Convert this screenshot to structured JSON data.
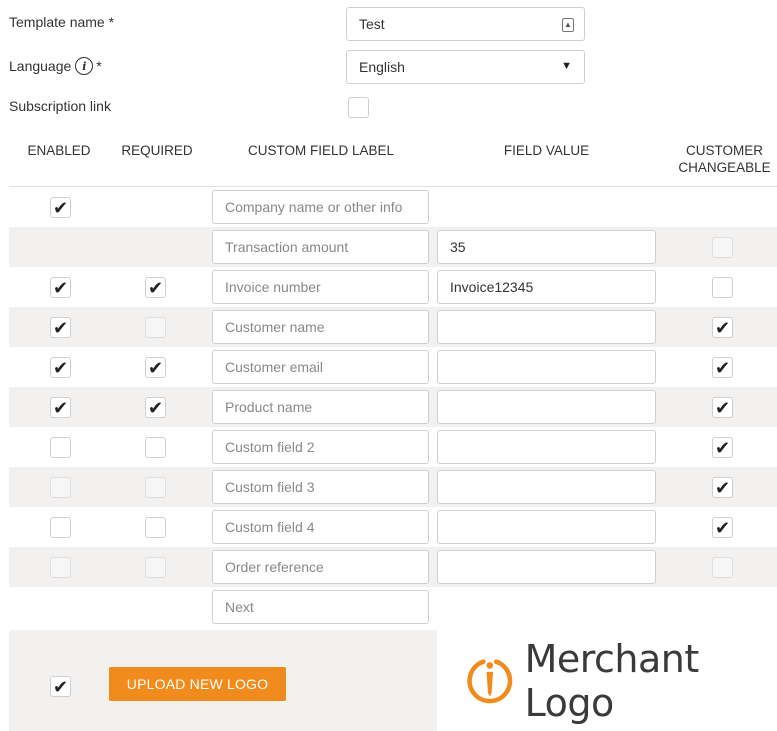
{
  "form": {
    "template_name_label": "Template name *",
    "template_name_value": "Test",
    "language_label": "Language",
    "language_required": "*",
    "language_value": "English",
    "subscription_label": "Subscription link",
    "subscription_checked": false
  },
  "table": {
    "headers": {
      "enabled": "ENABLED",
      "required": "REQUIRED",
      "label": "CUSTOM FIELD LABEL",
      "value": "FIELD VALUE",
      "changeable_1": "CUSTOMER",
      "changeable_2": "CHANGEABLE"
    },
    "rows": [
      {
        "label": "Company name or other info",
        "value": "",
        "enabled": true,
        "required": null,
        "changeable": null,
        "has_value": false
      },
      {
        "label": "Transaction amount",
        "value": "35",
        "enabled": null,
        "required": null,
        "changeable": "disabled",
        "has_value": true
      },
      {
        "label": "Invoice number",
        "value": "Invoice12345",
        "enabled": true,
        "required": true,
        "changeable": false,
        "has_value": true
      },
      {
        "label": "Customer name",
        "value": "",
        "enabled": true,
        "required": "disabled",
        "changeable": true,
        "has_value": true
      },
      {
        "label": "Customer email",
        "value": "",
        "enabled": true,
        "required": true,
        "changeable": true,
        "has_value": true
      },
      {
        "label": "Product name",
        "value": "",
        "enabled": true,
        "required": true,
        "changeable": true,
        "has_value": true
      },
      {
        "label": "Custom field 2",
        "value": "",
        "enabled": false,
        "required": false,
        "changeable": true,
        "has_value": true
      },
      {
        "label": "Custom field 3",
        "value": "",
        "enabled": "disabled",
        "required": "disabled",
        "changeable": true,
        "has_value": true
      },
      {
        "label": "Custom field 4",
        "value": "",
        "enabled": false,
        "required": false,
        "changeable": true,
        "has_value": true
      },
      {
        "label": "Order reference",
        "value": "",
        "enabled": "disabled",
        "required": "disabled",
        "changeable": "disabled",
        "has_value": true
      },
      {
        "label": "Next",
        "value": "",
        "enabled": null,
        "required": null,
        "changeable": null,
        "has_value": false
      }
    ]
  },
  "logo_section": {
    "enabled_checked": true,
    "upload_button": "UPLOAD NEW LOGO",
    "logo_text": "Merchant Logo"
  },
  "colors": {
    "accent": "#f18b1c",
    "row_shade": "#f2f1ef"
  }
}
